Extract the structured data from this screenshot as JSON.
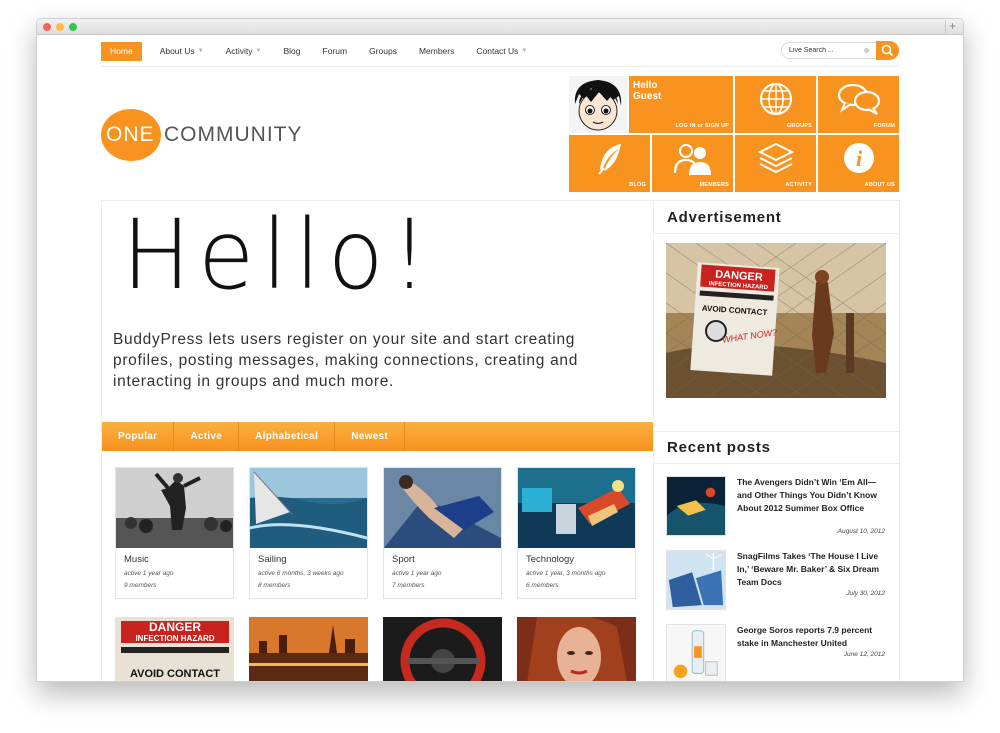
{
  "nav": {
    "items": [
      {
        "label": "Home",
        "active": true,
        "caret": false
      },
      {
        "label": "About Us",
        "caret": true
      },
      {
        "label": "Activity",
        "caret": true
      },
      {
        "label": "Blog",
        "caret": false
      },
      {
        "label": "Forum",
        "caret": false
      },
      {
        "label": "Groups",
        "caret": false
      },
      {
        "label": "Members",
        "caret": false
      },
      {
        "label": "Contact Us",
        "caret": true
      }
    ],
    "search_value": "Live Search ...",
    "search_icon": "search-icon"
  },
  "logo": {
    "one": "ONE",
    "word": "COMMUNITY"
  },
  "tiles": {
    "hello_line1": "Hello",
    "hello_line2": "Guest",
    "login_label": "LOG IN or SIGN UP",
    "groups_label": "GROUPS",
    "forum_label": "FORUM",
    "blog_label": "BLOG",
    "members_label": "MEMBERS",
    "activity_label": "ACTIVITY",
    "about_label": "ABOUT US"
  },
  "hero": {
    "title": "Hello!",
    "text": "BuddyPress lets users register on your site and start creating profiles, posting messages, making connections, creating and interacting in groups and much more."
  },
  "tabs": [
    "Popular",
    "Active",
    "Alphabetical",
    "Newest"
  ],
  "groups": [
    {
      "name": "Music",
      "meta": "active 1 year ago",
      "members": "9 members"
    },
    {
      "name": "Sailing",
      "meta": "active 6 months, 3 weeks ago",
      "members": "8 members"
    },
    {
      "name": "Sport",
      "meta": "active 1 year ago",
      "members": "7 members"
    },
    {
      "name": "Technology",
      "meta": "active 1 year, 3 months ago",
      "members": "6 members"
    }
  ],
  "sidebar": {
    "ad_title": "Advertisement",
    "recent_title": "Recent posts",
    "posts": [
      {
        "title": "The Avengers Didn’t Win ‘Em All—and Other Things You Didn’t Know About 2012 Summer Box Office",
        "date": "August 10, 2012"
      },
      {
        "title": "SnagFilms Takes ‘The House I Live In,’ ‘Beware Mr. Baker’ & Six Dream Team Docs",
        "date": "July 30, 2012"
      },
      {
        "title": "George Soros reports 7.9 percent stake in Manchester United",
        "date": "June 12, 2012"
      }
    ]
  },
  "colors": {
    "accent": "#f7931e",
    "text": "#333333"
  }
}
